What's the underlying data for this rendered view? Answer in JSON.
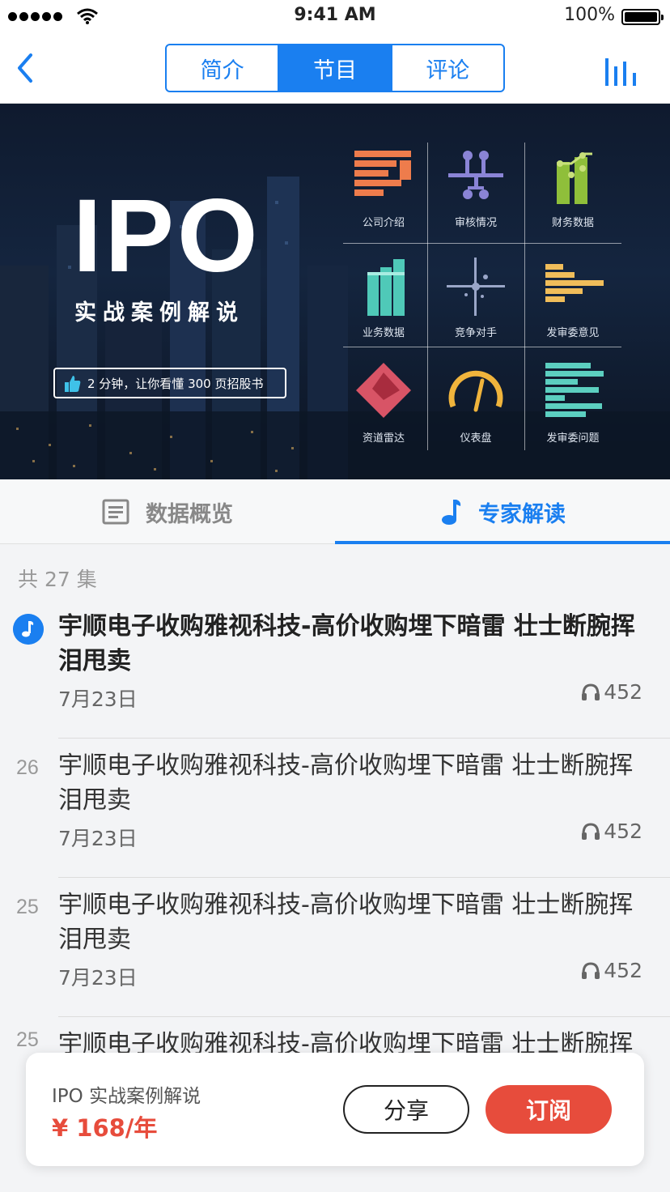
{
  "status_bar": {
    "time": "9:41 AM",
    "battery": "100%"
  },
  "nav": {
    "tabs": [
      {
        "label": "简介",
        "active": false
      },
      {
        "label": "节目",
        "active": true
      },
      {
        "label": "评论",
        "active": false
      }
    ],
    "accent": "#1a7ff0"
  },
  "banner": {
    "title": "IPO",
    "subtitle": "实战案例解说",
    "pill": "2 分钟，让你看懂 300 页招股书",
    "cells": [
      {
        "label": "公司介绍",
        "icon": "company-intro-icon"
      },
      {
        "label": "审核情况",
        "icon": "review-status-icon"
      },
      {
        "label": "财务数据",
        "icon": "financial-data-icon"
      },
      {
        "label": "业务数据",
        "icon": "business-data-icon"
      },
      {
        "label": "竞争对手",
        "icon": "competitors-icon"
      },
      {
        "label": "发审委意见",
        "icon": "committee-opinion-icon"
      },
      {
        "label": "资道雷达",
        "icon": "radar-icon"
      },
      {
        "label": "仪表盘",
        "icon": "dashboard-icon"
      },
      {
        "label": "发审委问题",
        "icon": "committee-questions-icon"
      }
    ]
  },
  "subtabs": [
    {
      "label": "数据概览",
      "icon": "document-icon",
      "active": false
    },
    {
      "label": "专家解读",
      "icon": "music-note-icon",
      "active": true
    }
  ],
  "list": {
    "count_label": "共 27 集",
    "items": [
      {
        "num": "",
        "title": "宇顺电子收购雅视科技-高价收购埋下暗雷 壮士断腕挥泪甩卖",
        "date": "7月23日",
        "plays": "452",
        "current": true
      },
      {
        "num": "26",
        "title": "宇顺电子收购雅视科技-高价收购埋下暗雷 壮士断腕挥泪甩卖",
        "date": "7月23日",
        "plays": "452",
        "current": false
      },
      {
        "num": "25",
        "title": "宇顺电子收购雅视科技-高价收购埋下暗雷 壮士断腕挥泪甩卖",
        "date": "7月23日",
        "plays": "452",
        "current": false
      },
      {
        "num": "25",
        "title": "宇顺电子收购雅视科技-高价收购埋下暗雷 壮士断腕挥泪甩卖",
        "date": "",
        "plays": "",
        "current": false
      }
    ]
  },
  "purchase": {
    "name": "IPO 实战案例解说",
    "price": "¥ 168/年",
    "share_label": "分享",
    "subscribe_label": "订阅"
  }
}
